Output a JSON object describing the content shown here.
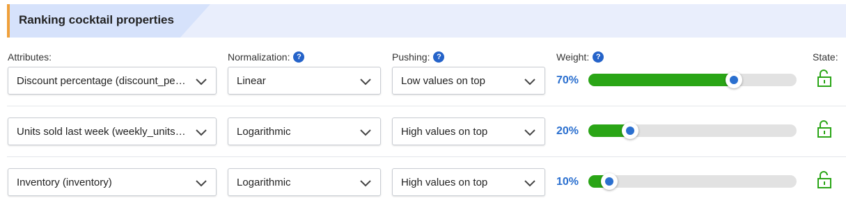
{
  "header": {
    "title": "Ranking cocktail properties"
  },
  "columns": {
    "attributes": "Attributes:",
    "normalization": "Normalization:",
    "pushing": "Pushing:",
    "weight": "Weight:",
    "state": "State:"
  },
  "help_icon_glyph": "?",
  "rows": [
    {
      "attribute": "Discount percentage (discount_perc...",
      "normalization": "Linear",
      "pushing": "Low values on top",
      "weight_label": "70%",
      "weight": 0.7,
      "state": "unlocked"
    },
    {
      "attribute": "Units sold last week (weekly_units_s...",
      "normalization": "Logarithmic",
      "pushing": "High values on top",
      "weight_label": "20%",
      "weight": 0.2,
      "state": "unlocked"
    },
    {
      "attribute": "Inventory (inventory)",
      "normalization": "Logarithmic",
      "pushing": "High values on top",
      "weight_label": "10%",
      "weight": 0.1,
      "state": "unlocked"
    }
  ],
  "colors": {
    "accent": "#f0a03a",
    "slider_fill": "#2aa516",
    "slider_thumb_dot": "#2a6fcf",
    "percent_text": "#2a6fcf",
    "lock_icon": "#2aa516"
  }
}
